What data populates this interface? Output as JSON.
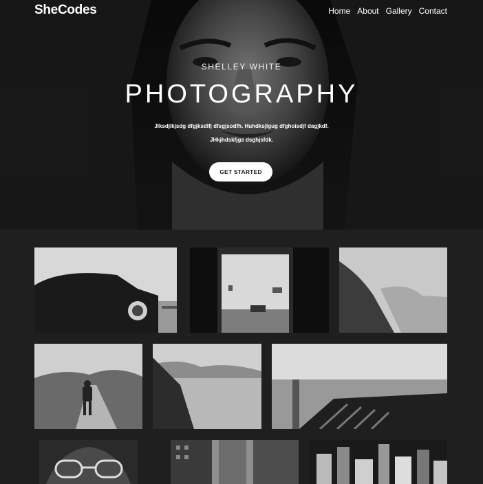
{
  "brand": "SheCodes",
  "nav": [
    {
      "label": "Home"
    },
    {
      "label": "About"
    },
    {
      "label": "Gallery"
    },
    {
      "label": "Contact"
    }
  ],
  "hero": {
    "kicker": "SHELLEY WHITE",
    "title": "PHOTOGRAPHY",
    "text": "Jlksdjlkjsdg dfgjksdlfj dfsgjsodfh. Huhdksjlgug dfghoisdjf dagjkdf. JHkjhdskfjgs dsghjsfdk.",
    "cta": "GET STARTED"
  },
  "gallery": [
    {
      "icon": "car-photo"
    },
    {
      "icon": "gallery-interior-photo"
    },
    {
      "icon": "coastal-cliff-photo"
    },
    {
      "icon": "man-on-road-photo"
    },
    {
      "icon": "lake-mountains-photo"
    },
    {
      "icon": "concrete-steps-photo"
    },
    {
      "icon": "face-glasses-photo"
    },
    {
      "icon": "skyscrapers-photo"
    },
    {
      "icon": "city-aerial-photo"
    }
  ],
  "colors": {
    "background": "#1f1f1f",
    "button": "#ffffff",
    "text": "#ffffff"
  }
}
